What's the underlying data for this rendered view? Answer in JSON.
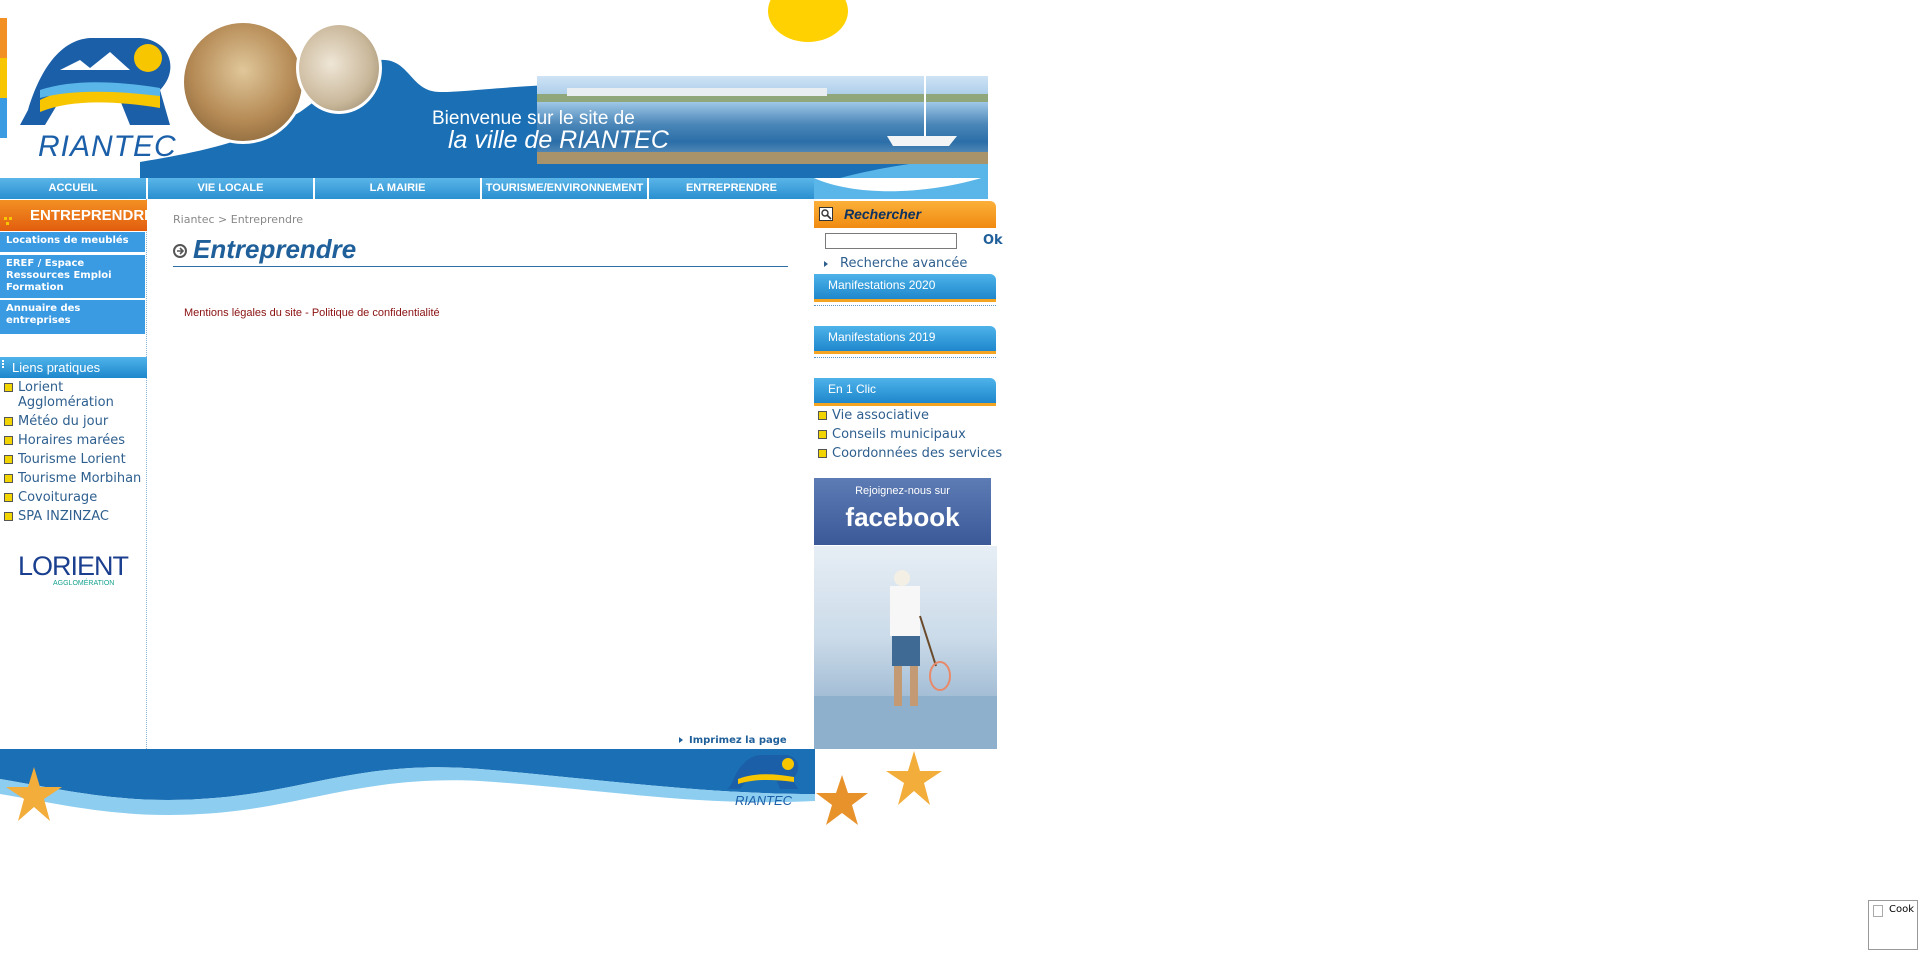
{
  "header": {
    "logo_text": "RIANTEC",
    "welcome_line1": "Bienvenue sur le site de",
    "welcome_line2": "la ville de RIANTEC"
  },
  "nav": {
    "items": [
      "ACCUEIL",
      "VIE LOCALE",
      "LA MAIRIE",
      "TOURISME/ENVIRONNEMENT",
      "ENTREPRENDRE"
    ]
  },
  "sidebar": {
    "section_title": "ENTREPRENDRE",
    "sub_items": [
      "Locations de meublés",
      "EREF / Espace Ressources Emploi Formation",
      "Annuaire des entreprises"
    ],
    "liens_title": "Liens pratiques",
    "liens": [
      "Lorient Agglomération",
      "Météo du jour",
      "Horaires marées",
      "Tourisme Lorient",
      "Tourisme Morbihan",
      "Covoiturage",
      "SPA INZINZAC"
    ],
    "partner_logo_text": "LORIENT",
    "partner_logo_sub": "AGGLOMÉRATION"
  },
  "main": {
    "breadcrumb": "Riantec > Entreprendre",
    "title": "Entreprendre",
    "legal_mentions": "Mentions légales du site",
    "legal_separator": "-",
    "privacy": "Politique de confidentialité",
    "print_label": "Imprimez la page"
  },
  "right": {
    "search_title": "Rechercher",
    "search_value": "",
    "ok_label": "Ok",
    "advanced_search": "Recherche avancée",
    "box_manif_2020": "Manifestations 2020",
    "box_manif_2019": "Manifestations 2019",
    "box_clic": "En 1 Clic",
    "clic_items": [
      "Vie associative",
      "Conseils municipaux",
      "Coordonnées des services"
    ],
    "facebook_line1": "Rejoignez-nous sur",
    "facebook_line2": "facebook"
  },
  "footer": {
    "logo_text": "RIANTEC"
  },
  "cookie": {
    "label": "Cook"
  },
  "colors": {
    "nav_blue": "#2a8fd0",
    "accent_orange": "#e25d0e",
    "title_blue": "#1f5f9a",
    "link_blue": "#2e5f8f",
    "legal_red": "#8a1010",
    "facebook_blue": "#3b5998"
  }
}
